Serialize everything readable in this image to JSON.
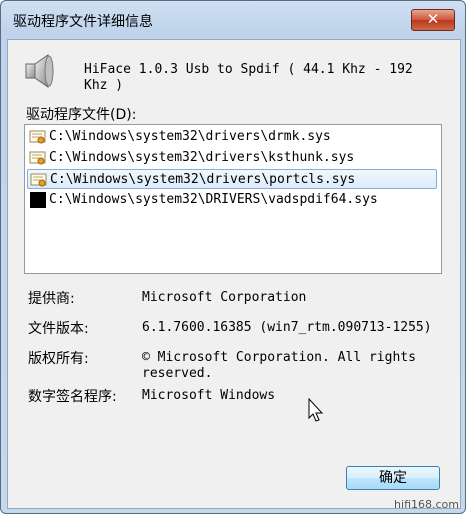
{
  "window": {
    "title": "驱动程序文件详细信息",
    "close_symbol": "✕"
  },
  "device": {
    "icon": "speaker-icon",
    "name": "HiFace 1.0.3 Usb to Spdif ( 44.1 Khz - 192 Khz )"
  },
  "file_list": {
    "label": "驱动程序文件(D):",
    "items": [
      {
        "path": "C:\\Windows\\system32\\drivers\\drmk.sys",
        "icon": "certificate-file-icon",
        "selected": false
      },
      {
        "path": "C:\\Windows\\system32\\drivers\\ksthunk.sys",
        "icon": "certificate-file-icon",
        "selected": false
      },
      {
        "path": "C:\\Windows\\system32\\drivers\\portcls.sys",
        "icon": "certificate-file-icon",
        "selected": true
      },
      {
        "path": "C:\\Windows\\system32\\DRIVERS\\vadspdif64.sys",
        "icon": "black-file-icon",
        "selected": false
      }
    ]
  },
  "properties": {
    "provider_label": "提供商:",
    "provider_value": "Microsoft Corporation",
    "version_label": "文件版本:",
    "version_value": "6.1.7600.16385 (win7_rtm.090713-1255)",
    "copyright_label": "版权所有:",
    "copyright_value": "© Microsoft Corporation. All rights reserved.",
    "signer_label": "数字签名程序:",
    "signer_value": "Microsoft Windows"
  },
  "buttons": {
    "ok_label": "确定"
  },
  "watermark": "hifi168.com",
  "colors": {
    "selection": "#dcebfc",
    "close_button": "#c84a30",
    "title_bg": "#c4d8ee"
  }
}
